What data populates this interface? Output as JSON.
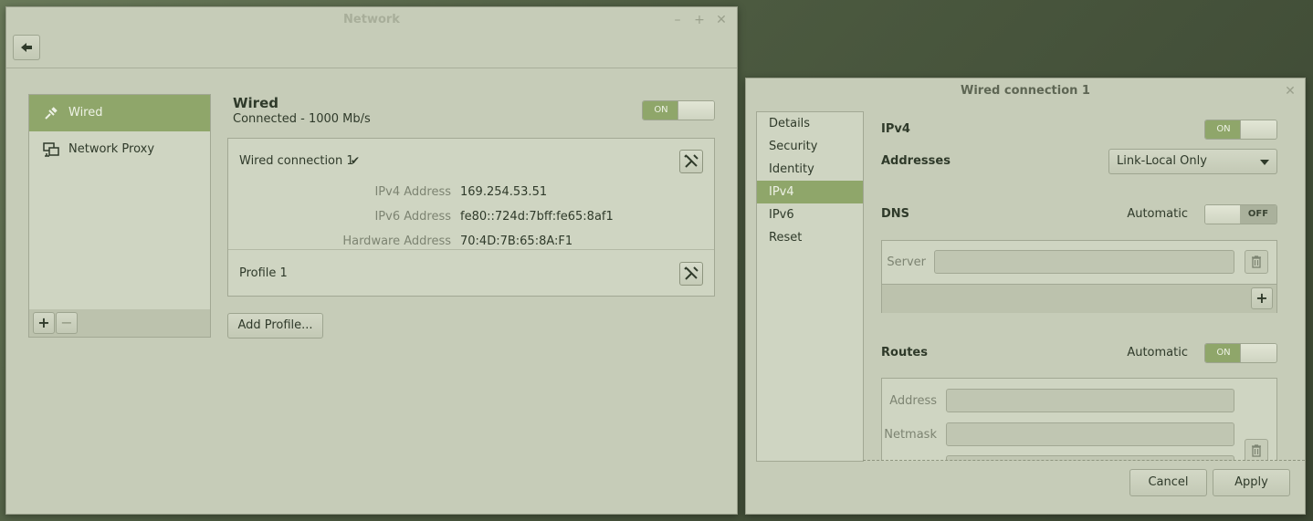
{
  "network_window": {
    "title": "Network",
    "sidebar": [
      {
        "label": "Wired",
        "icon": "wired-plug-icon",
        "selected": true
      },
      {
        "label": "Network Proxy",
        "icon": "network-proxy-icon",
        "selected": false
      }
    ],
    "add_symbol": "+",
    "remove_symbol": "−",
    "wired": {
      "title": "Wired",
      "status": "Connected - 1000 Mb/s",
      "toggle": "ON"
    },
    "connection": {
      "name": "Wired connection 1",
      "check": "✔",
      "details": [
        {
          "label": "IPv4 Address",
          "value": "169.254.53.51"
        },
        {
          "label": "IPv6 Address",
          "value": "fe80::724d:7bff:fe65:8af1"
        },
        {
          "label": "Hardware Address",
          "value": "70:4D:7B:65:8A:F1"
        }
      ]
    },
    "profile": {
      "name": "Profile 1"
    },
    "add_profile_label": "Add Profile..."
  },
  "dialog": {
    "title": "Wired connection 1",
    "nav": [
      {
        "label": "Details",
        "selected": false
      },
      {
        "label": "Security",
        "selected": false
      },
      {
        "label": "Identity",
        "selected": false
      },
      {
        "label": "IPv4",
        "selected": true
      },
      {
        "label": "IPv6",
        "selected": false
      },
      {
        "label": "Reset",
        "selected": false
      }
    ],
    "ipv4": {
      "label": "IPv4",
      "toggle": "ON"
    },
    "addresses": {
      "label": "Addresses",
      "selected": "Link-Local Only"
    },
    "dns": {
      "label": "DNS",
      "automatic_label": "Automatic",
      "toggle": "OFF",
      "server_label": "Server",
      "add_symbol": "+"
    },
    "routes": {
      "label": "Routes",
      "automatic_label": "Automatic",
      "toggle": "ON",
      "address_label": "Address",
      "netmask_label": "Netmask"
    },
    "cancel_label": "Cancel",
    "apply_label": "Apply"
  },
  "colors": {
    "accent": "#8fa66a",
    "window_bg": "#c6ccb8",
    "panel_bg": "#cfd5c2"
  }
}
